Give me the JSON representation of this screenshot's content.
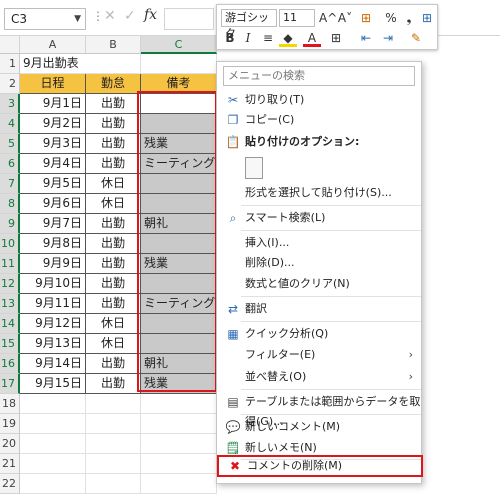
{
  "formula_bar": {
    "name_box": "C3",
    "fx": "fx"
  },
  "columns": [
    "A",
    "B",
    "C"
  ],
  "rows": [
    "1",
    "2",
    "3",
    "4",
    "5",
    "6",
    "7",
    "8",
    "9",
    "10",
    "11",
    "12",
    "13",
    "14",
    "15",
    "16",
    "17",
    "18",
    "19",
    "20",
    "21",
    "22"
  ],
  "sheet": {
    "title": "9月出勤表",
    "headers": [
      "日程",
      "勤怠",
      "備考"
    ],
    "data": [
      [
        "9月1日",
        "出勤",
        ""
      ],
      [
        "9月2日",
        "出勤",
        ""
      ],
      [
        "9月3日",
        "出勤",
        "残業"
      ],
      [
        "9月4日",
        "出勤",
        "ミーティング"
      ],
      [
        "9月5日",
        "休日",
        ""
      ],
      [
        "9月6日",
        "休日",
        ""
      ],
      [
        "9月7日",
        "出勤",
        "朝礼"
      ],
      [
        "9月8日",
        "出勤",
        ""
      ],
      [
        "9月9日",
        "出勤",
        "残業"
      ],
      [
        "9月10日",
        "出勤",
        ""
      ],
      [
        "9月11日",
        "出勤",
        "ミーティング"
      ],
      [
        "9月12日",
        "休日",
        ""
      ],
      [
        "9月13日",
        "休日",
        ""
      ],
      [
        "9月14日",
        "出勤",
        "朝礼"
      ],
      [
        "9月15日",
        "出勤",
        "残業"
      ]
    ]
  },
  "mini_toolbar": {
    "font": "游ゴシック",
    "size": "11",
    "row1": [
      "A^",
      "A˅",
      "⊞",
      "%",
      "❟",
      "⊞"
    ],
    "row2": [
      "B",
      "I",
      "≡",
      "A",
      "⊞",
      "⇤",
      "⇥",
      "✎"
    ]
  },
  "context_menu": {
    "search_placeholder": "メニューの検索",
    "cut": "切り取り(T)",
    "copy": "コピー(C)",
    "paste_options": "貼り付けのオプション:",
    "paste_special": "形式を選択して貼り付け(S)...",
    "smart_search": "スマート検索(L)",
    "insert": "挿入(I)...",
    "delete": "削除(D)...",
    "clear": "数式と値のクリア(N)",
    "translate": "翻訳",
    "quick_analysis": "クイック分析(Q)",
    "filter": "フィルター(E)",
    "sort": "並べ替え(O)",
    "get_data": "テーブルまたは範囲からデータを取得(G)...",
    "new_comment": "新しいコメント(M)",
    "new_note": "新しいメモ(N)",
    "delete_comment": "コメントの削除(M)"
  },
  "colors": {
    "header_fill": "#f5c242",
    "comment_fill": "#c9c9c9",
    "highlight": "#e0151a",
    "accent": "#117a3c"
  }
}
